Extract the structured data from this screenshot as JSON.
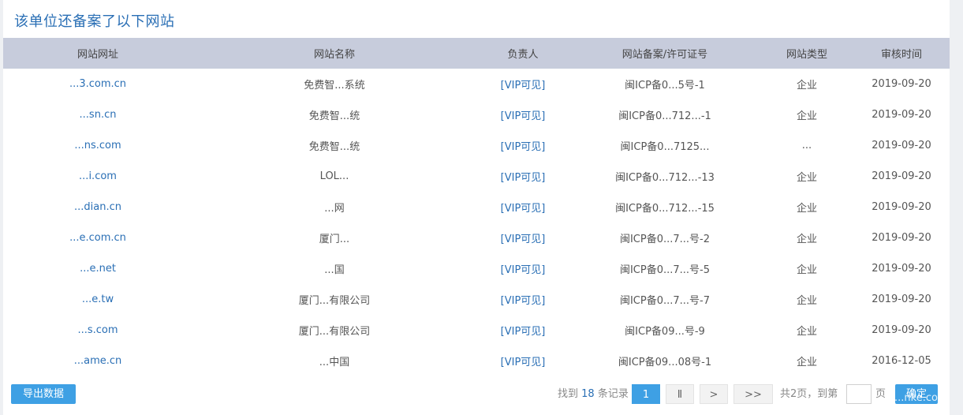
{
  "title": "该单位还备案了以下网站",
  "table": {
    "headers": [
      "网站网址",
      "网站名称",
      "负责人",
      "网站备案/许可证号",
      "网站类型",
      "审核时间"
    ],
    "rows": [
      [
        "...3.com.cn",
        "免费智...系统",
        "[VIP可见]",
        "闽ICP备0...5号-1",
        "企业",
        "2019-09-20"
      ],
      [
        "...sn.cn",
        "免费智...统",
        "[VIP可见]",
        "闽ICP备0...712...-1",
        "企业",
        "2019-09-20"
      ],
      [
        "...ns.com",
        "免费智...统",
        "[VIP可见]",
        "闽ICP备0...7125...",
        "...",
        "2019-09-20"
      ],
      [
        "...i.com",
        "LOL...",
        "[VIP可见]",
        "闽ICP备0...712...-13",
        "企业",
        "2019-09-20"
      ],
      [
        "...dian.cn",
        "...网",
        "[VIP可见]",
        "闽ICP备0...712...-15",
        "企业",
        "2019-09-20"
      ],
      [
        "...e.com.cn",
        "厦门...",
        "[VIP可见]",
        "闽ICP备0...7...号-2",
        "企业",
        "2019-09-20"
      ],
      [
        "...e.net",
        "...国",
        "[VIP可见]",
        "闽ICP备0...7...号-5",
        "企业",
        "2019-09-20"
      ],
      [
        "...e.tw",
        "厦门...有限公司",
        "[VIP可见]",
        "闽ICP备0...7...号-7",
        "企业",
        "2019-09-20"
      ],
      [
        "...s.com",
        "厦门...有限公司",
        "[VIP可见]",
        "闽ICP备09...号-9",
        "企业",
        "2019-09-20"
      ],
      [
        "...ame.cn",
        "...中国",
        "[VIP可见]",
        "闽ICP备09...08号-1",
        "企业",
        "2016-12-05"
      ]
    ]
  },
  "footer": {
    "export_label": "导出数据",
    "found_prefix": "找到",
    "found_count": "18",
    "found_suffix": "条记录",
    "page_current": "1",
    "page_2": "Ⅱ",
    "next": ">",
    "last": ">>",
    "total_pages": "共2页，到第",
    "page_unit": "页",
    "confirm_label": "确定",
    "watermark": "...nke.com"
  },
  "colors": {
    "accent": "#3ea0e4",
    "link": "#2a6fb5",
    "header_bg": "#c7ccdc"
  }
}
